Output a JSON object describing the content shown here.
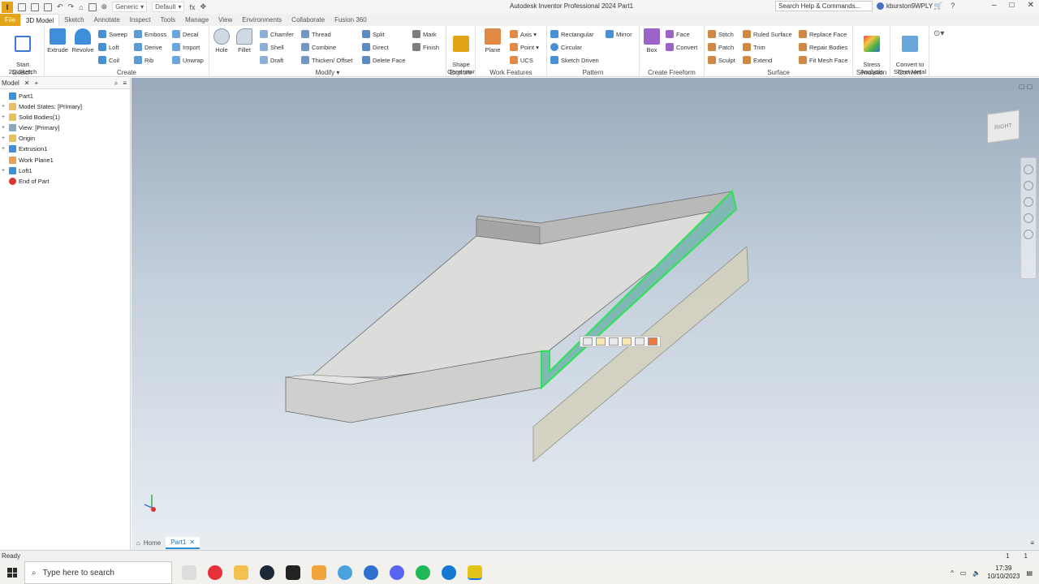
{
  "app": {
    "logo_letter": "I",
    "title": "Autodesk Inventor Professional 2024   Part1",
    "material_dropdown": "Generic",
    "appearance_dropdown": "Default",
    "search_placeholder": "Search Help & Commands...",
    "user": "kburston9WPLY",
    "window_controls": [
      "–",
      "□",
      "✕"
    ]
  },
  "tabs": [
    "File",
    "3D Model",
    "Sketch",
    "Annotate",
    "Inspect",
    "Tools",
    "Manage",
    "View",
    "Environments",
    "Collaborate",
    "Fusion 360"
  ],
  "ribbon": {
    "sketch": {
      "title": "Sketch",
      "start_label": "Start\n2D Sketch"
    },
    "create": {
      "title": "Create",
      "extrude": "Extrude",
      "revolve": "Revolve",
      "small": [
        "Sweep",
        "Loft",
        "Coil",
        "Emboss",
        "Derive",
        "Rib",
        "Decal",
        "Import",
        "Unwrap"
      ]
    },
    "modify": {
      "title": "Modify ▾",
      "hole": "Hole",
      "fillet": "Fillet",
      "small": [
        "Chamfer",
        "Shell",
        "Draft",
        "Thread",
        "Combine",
        "Thicken/ Offset",
        "Split",
        "Direct",
        "Delete Face",
        "Mark",
        "Finish"
      ]
    },
    "explore": {
      "title": "Explore",
      "shape_generator": "Shape\nGenerator"
    },
    "work_features": {
      "title": "Work Features",
      "plane": "Plane",
      "small": [
        "Axis ▾",
        "Point ▾",
        "UCS"
      ]
    },
    "pattern": {
      "title": "Pattern",
      "small": [
        "Rectangular",
        "Circular",
        "Sketch Driven",
        "Mirror"
      ]
    },
    "freeform": {
      "title": "Create Freeform",
      "box": "Box",
      "small": [
        "Face",
        "Convert"
      ]
    },
    "surface": {
      "title": "Surface",
      "small": [
        "Stitch",
        "Patch",
        "Sculpt",
        "Ruled Surface",
        "Trim",
        "Extend",
        "Replace Face",
        "Repair Bodies",
        "Fit Mesh Face"
      ]
    },
    "simulation": {
      "title": "Simulation",
      "stress": "Stress\nAnalysis"
    },
    "convert": {
      "title": "Convert",
      "sheet_metal": "Convert to\nSheet Metal"
    }
  },
  "browser": {
    "tab": "Model",
    "items": [
      {
        "label": "Part1",
        "expander": ""
      },
      {
        "label": "Model States: [Primary]",
        "expander": "+"
      },
      {
        "label": "Solid Bodies(1)",
        "expander": "+"
      },
      {
        "label": "View: [Primary]",
        "expander": "+"
      },
      {
        "label": "Origin",
        "expander": "+"
      },
      {
        "label": "Extrusion1",
        "expander": "+"
      },
      {
        "label": "Work Plane1",
        "expander": ""
      },
      {
        "label": "Loft1",
        "expander": "+"
      },
      {
        "label": "End of Part",
        "expander": ""
      }
    ]
  },
  "viewcube_label": "RIGHT",
  "doc_tabs": {
    "home": "Home",
    "part": "Part1"
  },
  "status": {
    "left": "Ready",
    "right": [
      "1",
      "1"
    ]
  },
  "taskbar": {
    "search": "Type here to search",
    "time": "17:39",
    "date": "10/10/2023"
  },
  "colors": {
    "accent": "#e3a41a",
    "selection": "#33e05a",
    "viewport_top": "#9aa9bb",
    "viewport_bottom": "#e6ecf2"
  }
}
